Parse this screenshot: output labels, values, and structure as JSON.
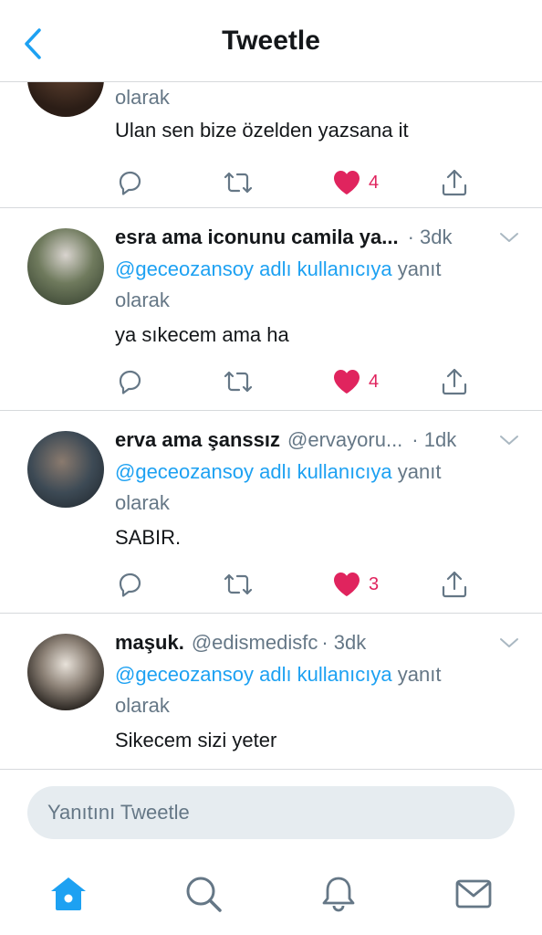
{
  "header": {
    "title": "Tweetle"
  },
  "colors": {
    "accent": "#1da1f2",
    "like": "#e0245e",
    "muted": "#657786",
    "text": "#14171a"
  },
  "tweets": [
    {
      "reply_tail": "olarak",
      "text": "Ulan sen bize özelden yazsana it",
      "likes": "4"
    },
    {
      "name": "esra ama iconunu camila ya...",
      "time": "· 3dk",
      "mention": "@geceozansoy adlı kullanıcıya",
      "reply_word": "yanıt",
      "reply_tail": "olarak",
      "text": "ya sıkecem ama ha",
      "likes": "4"
    },
    {
      "name": "erva ama şanssız",
      "handle": "@ervayoru...",
      "time": "· 1dk",
      "mention": "@geceozansoy adlı kullanıcıya",
      "reply_word": "yanıt",
      "reply_tail": "olarak",
      "text": "SABIR.",
      "likes": "3"
    },
    {
      "name": "maşuk.",
      "handle": "@edismedisfc",
      "time": "· 3dk",
      "mention": "@geceozansoy adlı kullanıcıya",
      "reply_word": "yanıt",
      "reply_tail": "olarak",
      "text": "Sikecem sizi yeter"
    }
  ],
  "reply_box": {
    "placeholder": "Yanıtını Tweetle"
  },
  "tabs": [
    "home-icon",
    "search-icon",
    "notifications-icon",
    "messages-icon"
  ]
}
